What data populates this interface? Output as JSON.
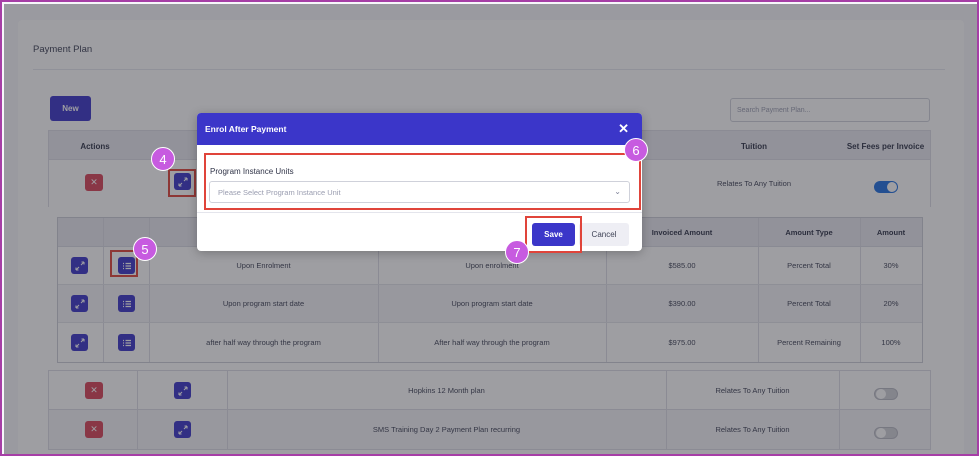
{
  "page": {
    "title": "Payment Plan",
    "new_label": "New",
    "search_placeholder": "Search Payment Plan..."
  },
  "main_table": {
    "headers": {
      "actions": "Actions",
      "tuition": "Tuition",
      "set_fees": "Set Fees per Invoice"
    },
    "rows": [
      {
        "tuition": "Relates To Any Tuition",
        "set_fees": true
      }
    ]
  },
  "sub_table": {
    "headers": {
      "invoiced_amount": "Invoiced Amount",
      "amount_type": "Amount Type",
      "amount": "Amount"
    },
    "rows": [
      {
        "name": "Upon Enrolment",
        "description": "Upon enrolment",
        "invoiced_amount": "$585.00",
        "amount_type": "Percent Total",
        "amount": "30%"
      },
      {
        "name": "Upon program start date",
        "description": "Upon program start date",
        "invoiced_amount": "$390.00",
        "amount_type": "Percent Total",
        "amount": "20%"
      },
      {
        "name": "after half way through the program",
        "description": "After half way through the program",
        "invoiced_amount": "$975.00",
        "amount_type": "Percent Remaining",
        "amount": "100%"
      }
    ]
  },
  "other_plans": [
    {
      "name": "Hopkins 12 Month plan",
      "tuition": "Relates To Any Tuition",
      "set_fees": false
    },
    {
      "name": "SMS Training Day 2 Payment Plan recurring",
      "tuition": "Relates To Any Tuition",
      "set_fees": false
    }
  ],
  "modal": {
    "title": "Enrol After Payment",
    "close_glyph": "✕",
    "field_label": "Program Instance Units",
    "select_placeholder": "Please Select Program Instance Unit",
    "save_label": "Save",
    "cancel_label": "Cancel"
  },
  "annotations": {
    "step4": "4",
    "step5": "5",
    "step6": "6",
    "step7": "7"
  },
  "colors": {
    "primary": "#3b36c9",
    "danger": "#d94458",
    "highlight": "#e0443a",
    "badge": "#c75be0",
    "toggle_on": "#1f6fe0",
    "frame": "#a63ea6"
  },
  "icons": {
    "delete": "close-icon",
    "expand": "expand-arrows-icon",
    "list": "list-icon",
    "dropdown": "chevron-down-icon"
  }
}
